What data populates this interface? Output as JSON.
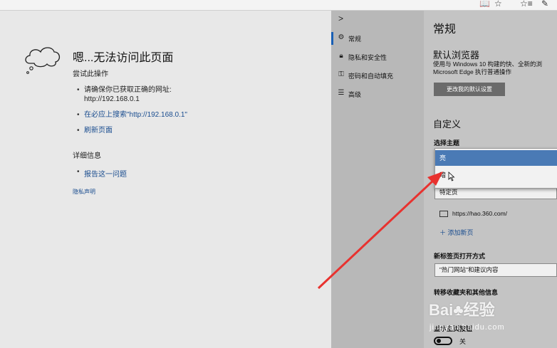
{
  "toolbar": {
    "reading_icon": "📖",
    "star_icon": "☆",
    "favorites_icon": "☆≡",
    "pen_icon": "✎"
  },
  "error": {
    "title": "嗯...无法访问此页面",
    "subtitle": "尝试此操作",
    "suggestions": [
      "请确保你已获取正确的网址:",
      "http://192.168.0.1",
      "在必应上搜索\"http://192.168.0.1\"",
      "刷新页面"
    ],
    "details_title": "详细信息",
    "report_link": "报告这一问题",
    "privacy_link": "隐私声明"
  },
  "nav": {
    "items": [
      {
        "label": "常规",
        "icon": "gear-icon"
      },
      {
        "label": "隐私和安全性",
        "icon": "lock-icon"
      },
      {
        "label": "密码和自动填充",
        "icon": "key-icon"
      },
      {
        "label": "高级",
        "icon": "sliders-icon"
      }
    ]
  },
  "settings": {
    "title": "常规",
    "default_browser_heading": "默认浏览器",
    "default_browser_desc_1": "使用与 Windows 10 构建的快、全新的浏",
    "default_browser_desc_2": "Microsoft Edge 执行普通操作",
    "change_default_button": "更改我的默认设置",
    "customize_heading": "自定义",
    "theme_label": "选择主题",
    "theme_options": [
      "亮",
      "暗"
    ],
    "open_with_value": "特定页",
    "page_url": "https://hao.360.com/",
    "add_new_page": "添加新页",
    "new_tab_label": "新标签页打开方式",
    "new_tab_value": "\"热门网站\"和建议内容",
    "transfer_label": "转移收藏夹和其他信息",
    "show_home_label": "显示主页按钮",
    "toggle_state": "关"
  },
  "watermark": {
    "brand": "Bai♣经验",
    "url": "jingyan.baidu.com"
  },
  "colors": {
    "arrow": "#e8322f",
    "selected_option": "#4a7ab5",
    "nav_active": "#1a5fb4"
  }
}
